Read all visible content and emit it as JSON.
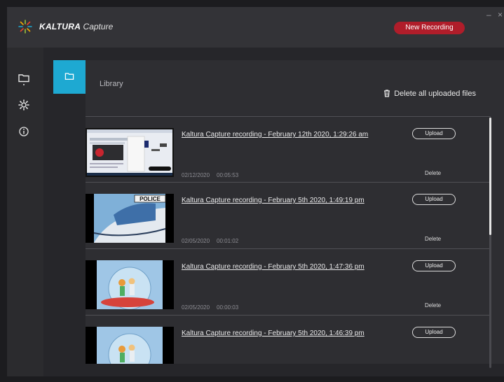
{
  "app": {
    "brand_bold": "KALTURA",
    "brand_light": "Capture"
  },
  "header": {
    "new_recording": "New Recording",
    "minimize": "–",
    "close": "×"
  },
  "sidebar": {
    "items": [
      "library-icon",
      "settings-icon",
      "info-icon"
    ]
  },
  "library": {
    "title": "Library",
    "delete_all": "Delete all uploaded files"
  },
  "recordings": [
    {
      "title": "Kaltura Capture recording - February 12th 2020, 1:29:26 am",
      "date": "02/12/2020",
      "duration": "00:05:53",
      "upload": "Upload",
      "delete": "Delete"
    },
    {
      "title": "Kaltura Capture recording - February 5th 2020, 1:49:19 pm",
      "date": "02/05/2020",
      "duration": "00:01:02",
      "upload": "Upload",
      "delete": "Delete"
    },
    {
      "title": "Kaltura Capture recording - February 5th 2020, 1:47:36 pm",
      "date": "02/05/2020",
      "duration": "00:00:03",
      "upload": "Upload",
      "delete": "Delete"
    },
    {
      "title": "Kaltura Capture recording - February 5th 2020, 1:46:39 pm",
      "date": "",
      "duration": "",
      "upload": "Upload",
      "delete": ""
    }
  ],
  "thumb2_text": "POLICE",
  "colors": {
    "accent": "#1ea9d2",
    "record": "#b01d2a",
    "bg": "#2b2b2e"
  }
}
